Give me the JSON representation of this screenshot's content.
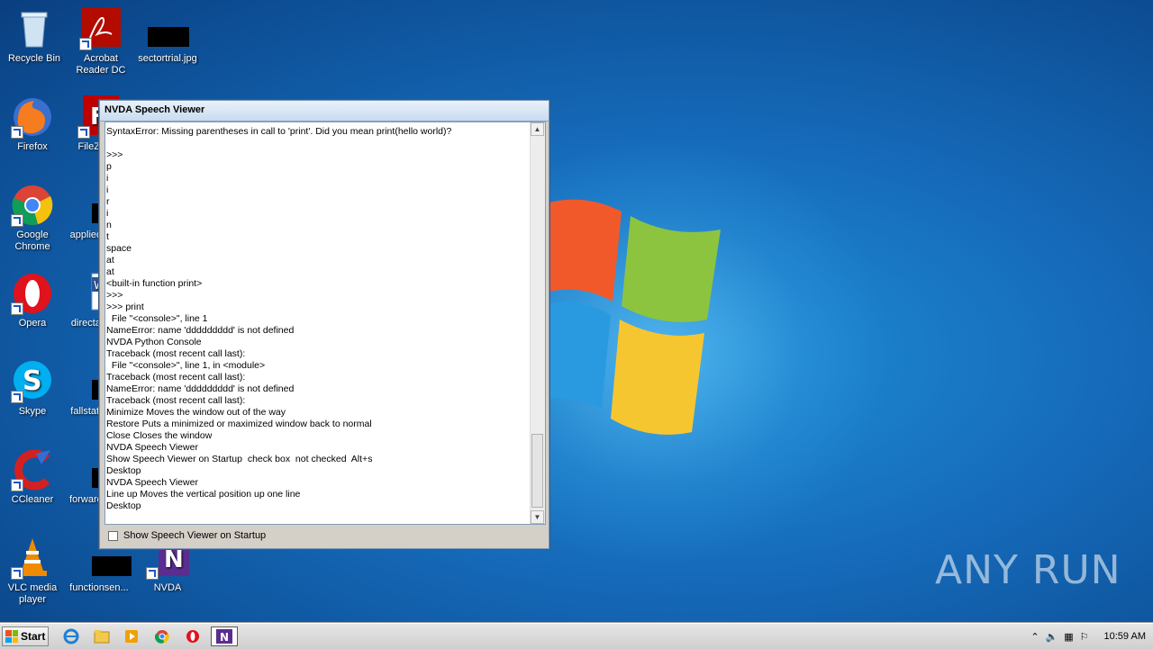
{
  "desktop": {
    "icons": [
      {
        "label": "Recycle Bin"
      },
      {
        "label": "Acrobat Reader DC"
      },
      {
        "label": "sectortrial.jpg"
      },
      {
        "label": "Firefox"
      },
      {
        "label": "FileZilla..."
      },
      {
        "label": "Google Chrome"
      },
      {
        "label": "applied..."
      },
      {
        "label": "Opera"
      },
      {
        "label": "directa..."
      },
      {
        "label": "Skype"
      },
      {
        "label": "fallstati..."
      },
      {
        "label": "CCleaner"
      },
      {
        "label": "forward..."
      },
      {
        "label": "VLC media player"
      },
      {
        "label": "functionsen..."
      },
      {
        "label": "NVDA"
      }
    ],
    "watermark": "ANY RUN"
  },
  "window": {
    "title": "NVDA Speech Viewer",
    "lines": [
      "SyntaxError: Missing parentheses in call to 'print'. Did you mean print(hello world)?",
      "",
      ">>>",
      "p",
      "i",
      "i",
      "r",
      "i",
      "n",
      "t",
      "space",
      "at",
      "at",
      "<built-in function print>",
      ">>>",
      ">>> print",
      "  File \"<console>\", line 1",
      "NameError: name 'ddddddddd' is not defined",
      "NVDA Python Console",
      "Traceback (most recent call last):",
      "  File \"<console>\", line 1, in <module>",
      "Traceback (most recent call last):",
      "NameError: name 'ddddddddd' is not defined",
      "Traceback (most recent call last):",
      "Minimize Moves the window out of the way",
      "Restore Puts a minimized or maximized window back to normal",
      "Close Closes the window",
      "NVDA Speech Viewer",
      "Show Speech Viewer on Startup  check box  not checked  Alt+s",
      "Desktop",
      "NVDA Speech Viewer",
      "Line up Moves the vertical position up one line",
      "Desktop"
    ],
    "checkbox_label": "Show Speech Viewer on Startup"
  },
  "taskbar": {
    "start_label": "Start",
    "clock": "10:59 AM"
  }
}
